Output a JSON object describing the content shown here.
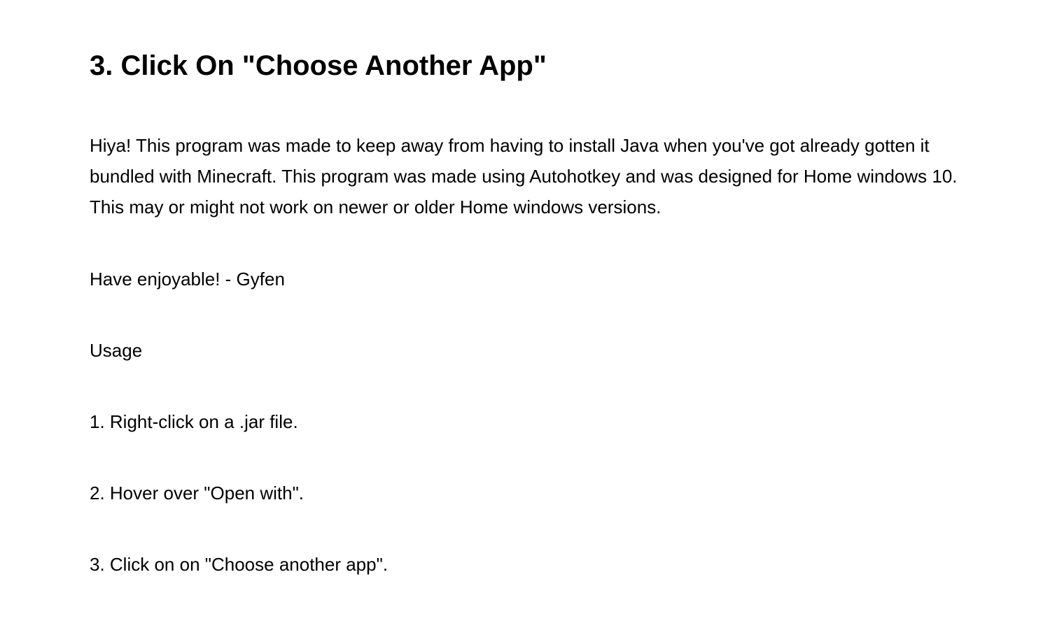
{
  "heading": "3. Click On \"Choose Another App\"",
  "intro": "Hiya! This program was made to keep away from having to install Java when you've got already gotten it bundled with Minecraft. This program was made using Autohotkey and was designed for Home windows 10. This may or might not work on newer or older Home windows versions.",
  "signoff": "Have enjoyable! - Gyfen",
  "usageLabel": "Usage",
  "steps": [
    "1. Right-click on a .jar file.",
    "2. Hover over \"Open with\".",
    "3. Click on on \"Choose another app\"."
  ]
}
